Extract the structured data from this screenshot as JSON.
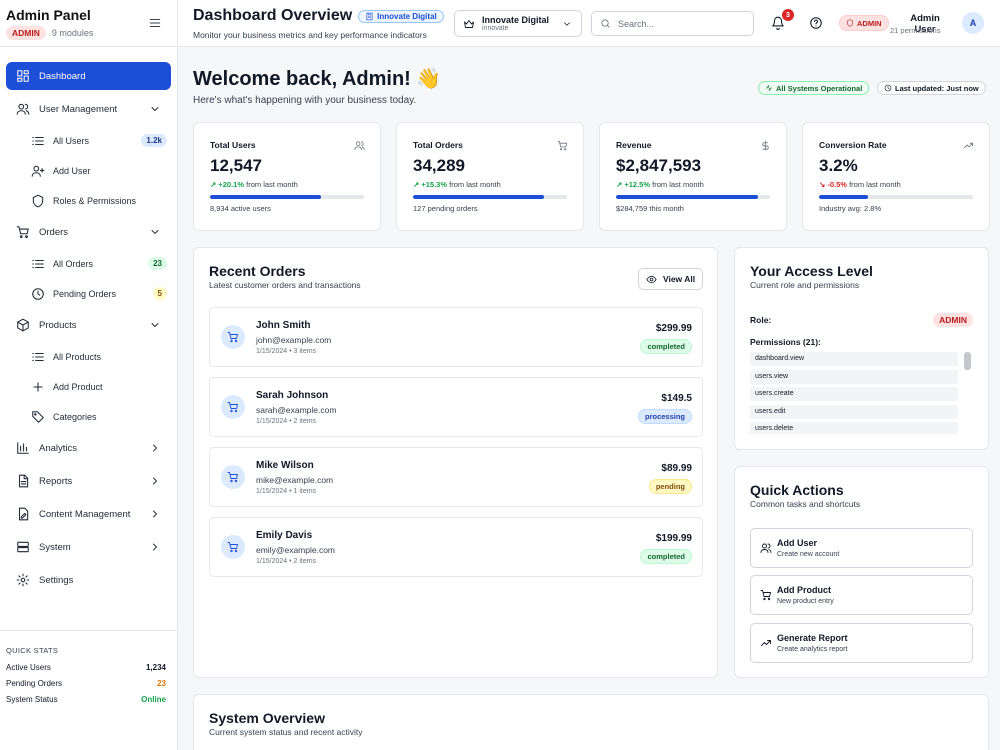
{
  "sidebar": {
    "title": "Admin Panel",
    "role_badge": "ADMIN",
    "modules": "9 modules",
    "items": [
      {
        "label": "Dashboard"
      },
      {
        "label": "User Management"
      },
      {
        "label": "All Users",
        "count": "1.2k"
      },
      {
        "label": "Add User"
      },
      {
        "label": "Roles & Permissions"
      },
      {
        "label": "Orders"
      },
      {
        "label": "All Orders",
        "count": "23"
      },
      {
        "label": "Pending Orders",
        "count": "5"
      },
      {
        "label": "Products"
      },
      {
        "label": "All Products"
      },
      {
        "label": "Add Product"
      },
      {
        "label": "Categories"
      },
      {
        "label": "Analytics"
      },
      {
        "label": "Reports"
      },
      {
        "label": "Content Management"
      },
      {
        "label": "System"
      },
      {
        "label": "Settings"
      }
    ],
    "quick_stats": {
      "title": "QUICK STATS",
      "rows": [
        {
          "label": "Active Users",
          "value": "1,234"
        },
        {
          "label": "Pending Orders",
          "value": "23"
        },
        {
          "label": "System Status",
          "value": "Online"
        }
      ]
    }
  },
  "header": {
    "title": "Dashboard Overview",
    "org_badge": "Innovate Digital",
    "subtitle": "Monitor your business metrics and key performance indicators",
    "org_select": {
      "name": "Innovate Digital",
      "slug": "innovate"
    },
    "search_placeholder": "Search...",
    "notifications": "3",
    "role": "ADMIN",
    "user_name": "Admin User",
    "user_permissions": "21 permissions",
    "avatar_initial": "A"
  },
  "welcome": {
    "title": "Welcome back, Admin! 👋",
    "subtitle": "Here's what's happening with your business today.",
    "status": "All Systems Operational",
    "updated": "Last updated: Just now"
  },
  "stats": [
    {
      "label": "Total Users",
      "value": "12,547",
      "change": "+20.1%",
      "change_suffix": "from last month",
      "direction": "up",
      "progress": 0.72,
      "note": "8,934 active users"
    },
    {
      "label": "Total Orders",
      "value": "34,289",
      "change": "+15.3%",
      "change_suffix": "from last month",
      "direction": "up",
      "progress": 0.85,
      "note": "127 pending orders"
    },
    {
      "label": "Revenue",
      "value": "$2,847,593",
      "change": "+12.5%",
      "change_suffix": "from last month",
      "direction": "up",
      "progress": 0.92,
      "note": "$284,759 this month"
    },
    {
      "label": "Conversion Rate",
      "value": "3.2%",
      "change": "-0.5%",
      "change_suffix": "from last month",
      "direction": "down",
      "progress": 0.32,
      "note": "Industry avg: 2.8%"
    }
  ],
  "orders": {
    "title": "Recent Orders",
    "subtitle": "Latest customer orders and transactions",
    "view_all": "View All",
    "list": [
      {
        "name": "John Smith",
        "email": "john@example.com",
        "meta": "1/15/2024 • 3 items",
        "amount": "$299.99",
        "status": "completed"
      },
      {
        "name": "Sarah Johnson",
        "email": "sarah@example.com",
        "meta": "1/15/2024 • 2 items",
        "amount": "$149.5",
        "status": "processing"
      },
      {
        "name": "Mike Wilson",
        "email": "mike@example.com",
        "meta": "1/15/2024 • 1 items",
        "amount": "$89.99",
        "status": "pending"
      },
      {
        "name": "Emily Davis",
        "email": "emily@example.com",
        "meta": "1/15/2024 • 2 items",
        "amount": "$199.99",
        "status": "completed"
      }
    ]
  },
  "access": {
    "title": "Your Access Level",
    "subtitle": "Current role and permissions",
    "role_label": "Role:",
    "role_value": "ADMIN",
    "permissions_label": "Permissions (21):",
    "permissions": [
      "dashboard.view",
      "users.view",
      "users.create",
      "users.edit",
      "users.delete"
    ]
  },
  "quick_actions": {
    "title": "Quick Actions",
    "subtitle": "Common tasks and shortcuts",
    "items": [
      {
        "title": "Add User",
        "subtitle": "Create new account"
      },
      {
        "title": "Add Product",
        "subtitle": "New product entry"
      },
      {
        "title": "Generate Report",
        "subtitle": "Create analytics report"
      }
    ]
  },
  "system_overview": {
    "title": "System Overview",
    "subtitle": "Current system status and recent activity"
  },
  "colors": {
    "accent": "#1d4ed8",
    "success": "#16a34a",
    "danger": "#dc2626",
    "warning": "#d97706"
  }
}
